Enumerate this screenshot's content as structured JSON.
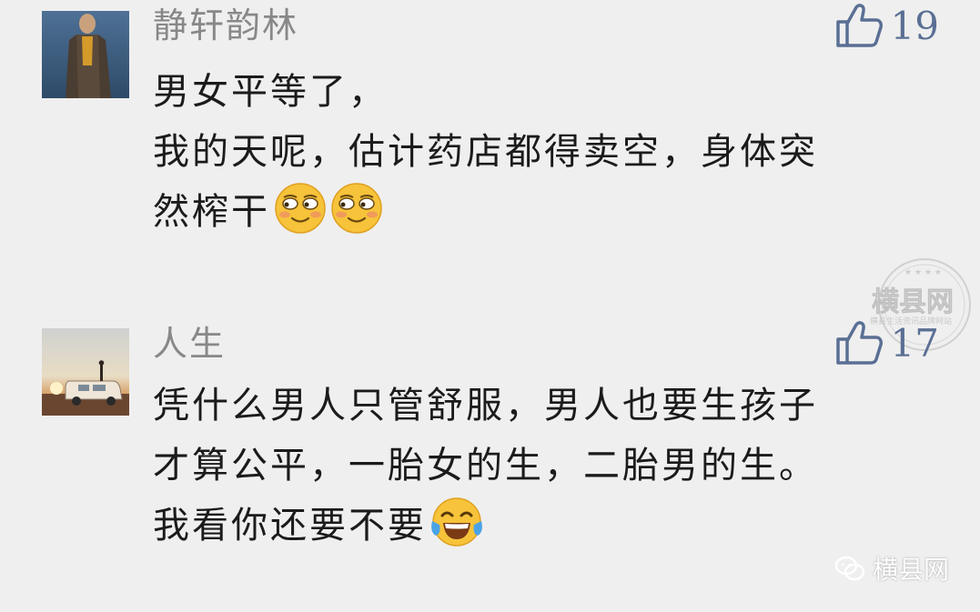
{
  "comments": [
    {
      "username": "静轩韵林",
      "likes": "19",
      "lines": [
        "男女平等了，",
        "我的天呢，估计药店都得卖空，身体突",
        "然榨干"
      ],
      "trailing_emojis": [
        "smirk-emoji",
        "smirk-emoji"
      ],
      "avatar": "person-standing-avatar"
    },
    {
      "username": "人生",
      "likes": "17",
      "lines": [
        "凭什么男人只管舒服，男人也要生孩子",
        "才算公平，一胎女的生，二胎男的生。",
        "我看你还要不要"
      ],
      "trailing_emojis": [
        "laugh-tears-emoji"
      ],
      "avatar": "van-sunset-avatar"
    }
  ],
  "watermark": {
    "seal_text": "横县网",
    "seal_subtext": "横县生活资讯品牌网站"
  },
  "footer": {
    "brand": "横县网"
  },
  "colors": {
    "background": "#efefef",
    "username": "#888888",
    "like_accent": "#5a6f94",
    "body_text": "#1b1b1b"
  }
}
